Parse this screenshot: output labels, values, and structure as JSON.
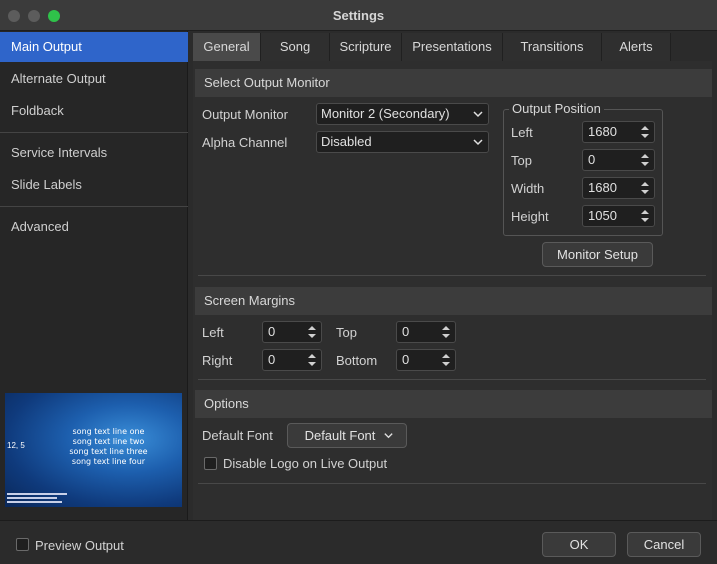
{
  "window": {
    "title": "Settings"
  },
  "sidebar": {
    "items": [
      {
        "label": "Main Output",
        "active": true
      },
      {
        "label": "Alternate Output"
      },
      {
        "label": "Foldback"
      },
      {
        "label": "Service Intervals"
      },
      {
        "label": "Slide Labels"
      },
      {
        "label": "Advanced"
      }
    ],
    "preview": {
      "coords": "12, 5",
      "lines": [
        "song text line one",
        "song text line two",
        "song text line three",
        "song text line four"
      ]
    }
  },
  "tabs": [
    {
      "label": "General",
      "active": true
    },
    {
      "label": "Song"
    },
    {
      "label": "Scripture"
    },
    {
      "label": "Presentations"
    },
    {
      "label": "Transitions"
    },
    {
      "label": "Alerts"
    }
  ],
  "select_output_monitor": {
    "heading": "Select Output Monitor",
    "output_monitor_label": "Output Monitor",
    "output_monitor_value": "Monitor 2 (Secondary)",
    "alpha_channel_label": "Alpha Channel",
    "alpha_channel_value": "Disabled",
    "output_position": {
      "title": "Output Position",
      "left_label": "Left",
      "left_value": "1680",
      "top_label": "Top",
      "top_value": "0",
      "width_label": "Width",
      "width_value": "1680",
      "height_label": "Height",
      "height_value": "1050"
    },
    "monitor_setup_button": "Monitor Setup"
  },
  "screen_margins": {
    "heading": "Screen Margins",
    "left_label": "Left",
    "left_value": "0",
    "top_label": "Top",
    "top_value": "0",
    "right_label": "Right",
    "right_value": "0",
    "bottom_label": "Bottom",
    "bottom_value": "0"
  },
  "options": {
    "heading": "Options",
    "default_font_label": "Default Font",
    "default_font_button": "Default Font",
    "disable_logo_label": "Disable Logo on Live Output"
  },
  "footer": {
    "preview_output_label": "Preview Output",
    "ok_button": "OK",
    "cancel_button": "Cancel"
  },
  "colors": {
    "accent": "#2f65ca",
    "close_light": "#5c5c5c",
    "maximize_light": "#2fc24a"
  }
}
